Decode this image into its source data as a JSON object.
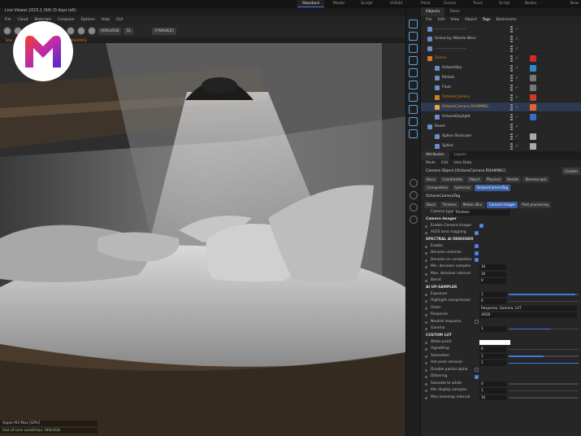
{
  "layouts": [
    {
      "label": "Standard",
      "active": true
    },
    {
      "label": "Model"
    },
    {
      "label": "Sculpt"
    },
    {
      "label": "UVEdit"
    },
    {
      "label": "Paint"
    },
    {
      "label": "Groom"
    },
    {
      "label": "Track"
    },
    {
      "label": "Script"
    },
    {
      "label": "Nodes"
    },
    {
      "label": "New La"
    }
  ],
  "viewer": {
    "title": "Live Viewer 2023.1 (94) (0 days left)",
    "menus": [
      "File",
      "Cloud",
      "Materials",
      "Compare",
      "Options",
      "Help",
      "GUI"
    ],
    "finished": "[FINISHED]",
    "colorspace": "HDR/sRGB",
    "mode": "DL",
    "status": "Total: 7 (Tone) Rendering bits 8 of the IRRADIANCE",
    "overlay_gpu": "Apple M3 Max [GPU]",
    "overlay_status": "Out-of-core used/max: 0Kb/4Gb"
  },
  "objects_panel": {
    "tabs": [
      {
        "label": "Objects",
        "active": true
      },
      {
        "label": "Takes"
      }
    ],
    "menus": [
      "File",
      "Edit",
      "View",
      "Object",
      "Tags",
      "Bookmarks"
    ],
    "rows": [
      {
        "name": "...........................",
        "indent": 0,
        "color": "#c8c8c8"
      },
      {
        "name": "Scene by Alberto Bleci",
        "indent": 0,
        "color": "#c8c8c8"
      },
      {
        "name": "...........................",
        "indent": 0,
        "color": "#c8c8c8"
      },
      {
        "name": "Scene",
        "indent": 0,
        "color": "#d07c2a"
      },
      {
        "name": "OctaneSky",
        "indent": 1,
        "color": "#c8c8c8"
      },
      {
        "name": "Portals",
        "indent": 1,
        "color": "#c8c8c8"
      },
      {
        "name": "Floor",
        "indent": 1,
        "color": "#c8c8c8"
      },
      {
        "name": "OctaneCamera",
        "indent": 1,
        "color": "#d07c2a"
      },
      {
        "name": "OctaneCamera.ROAMING",
        "indent": 1,
        "color": "#e6a640"
      },
      {
        "name": "OctaneDaylight",
        "indent": 1,
        "color": "#c8c8c8"
      },
      {
        "name": "Room",
        "indent": 0,
        "color": "#c8c8c8"
      },
      {
        "name": "Spline Staircase",
        "indent": 1,
        "color": "#c8c8c8"
      },
      {
        "name": "Spline",
        "indent": 1,
        "color": "#c8c8c8"
      }
    ]
  },
  "attributes": {
    "tabs": [
      {
        "label": "Attributes",
        "active": true
      },
      {
        "label": "Layers"
      }
    ],
    "menus": [
      "Mode",
      "Edit",
      "User Data"
    ],
    "header": "Camera Object [OctaneCamera.ROAMING]",
    "custom_label": "Custom",
    "row1": [
      "Basic",
      "Coordinates",
      "Object",
      "Physical",
      "Details",
      "Stereoscopic"
    ],
    "row2": [
      "Composition",
      "Spherical",
      "OctaneCameraTag"
    ],
    "tag_title": "OctaneCameraTag",
    "subtabs": [
      "Basic",
      "Thinlens",
      "Motion Blur",
      "Camera Imager",
      "Post processing"
    ],
    "active_subtab": "Camera Imager",
    "camera_type_label": "Camera type",
    "camera_type_value": "Thinlens",
    "imager_title": "Camera Imager",
    "enable_imager": "Enable Camera Imager",
    "aces": "ACES tone mapping",
    "spectral_title": "SPECTRAL AI DENOISER",
    "spectral": [
      {
        "label": "Enable",
        "check": true
      },
      {
        "label": "Denoise volumes",
        "check": true
      },
      {
        "label": "Denoise on completion",
        "check": true
      },
      {
        "label": "Min. denoiser samples",
        "value": "10"
      },
      {
        "label": "Max. denoiser interval",
        "value": "20"
      },
      {
        "label": "Blend",
        "value": "0"
      }
    ],
    "upsampler": "AI UP-SAMPLER",
    "props": [
      {
        "label": "Exposure",
        "value": "1",
        "slider": 0.95
      },
      {
        "label": "Highlight compression",
        "value": "0",
        "slider": 0
      },
      {
        "label": "Order",
        "wide": "Response, Gamma, LUT"
      },
      {
        "label": "Response",
        "wide": "sRGB"
      },
      {
        "label": "Neutral response",
        "check": false
      },
      {
        "label": "Gamma",
        "value": "1",
        "slider": 0.6
      }
    ],
    "lut_title": "CUSTOM LUT",
    "props2": [
      {
        "label": "White point",
        "swatch": "#ffffff"
      },
      {
        "label": "Vignetting",
        "value": "0",
        "slider": 0
      },
      {
        "label": "Saturation",
        "value": "1",
        "slider": 0.5
      },
      {
        "label": "Hot pixel removal",
        "value": "1",
        "slider": 1
      },
      {
        "label": "Disable partial alpha",
        "check": false
      },
      {
        "label": "Dithering",
        "check": true
      },
      {
        "label": "Saturate to white",
        "value": "0",
        "slider": 0
      },
      {
        "label": "Min display samples",
        "value": "1",
        "slider": 0
      },
      {
        "label": "Max tonemap interval",
        "value": "10",
        "slider": 0
      }
    ]
  }
}
